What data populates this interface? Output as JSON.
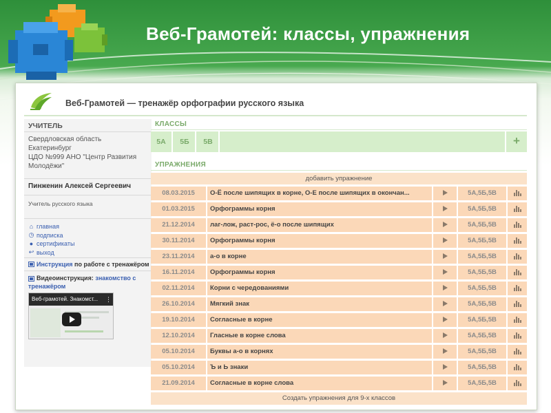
{
  "slide": {
    "title": "Веб-Грамотей: классы, упражнения"
  },
  "app": {
    "title": "Веб-Грамотей — тренажёр орфографии русского языка"
  },
  "sidebar": {
    "heading": "УЧИТЕЛЬ",
    "org_lines": [
      "Свердловская область",
      "Екатеринбург",
      "ЦДО №999 АНО \"Центр Развития",
      "Молодёжи\""
    ],
    "teacher_name": "Пинженин Алексей Сергеевич",
    "teacher_role": "Учитель русского языка",
    "links": [
      {
        "icon": "home-icon",
        "label": "главная"
      },
      {
        "icon": "subscription-icon",
        "label": "подписка"
      },
      {
        "icon": "certificate-icon",
        "label": "сертификаты"
      },
      {
        "icon": "logout-icon",
        "label": "выход"
      }
    ],
    "instruction": {
      "link": "Инструкция",
      "text": " по работе с тренажёром"
    },
    "video": {
      "label": "Видеоинструкция:",
      "link": "знакомство с тренажёром",
      "thumb_title": "Веб-грамотей. Знакомст..."
    }
  },
  "classes": {
    "heading": "КЛАССЫ",
    "items": [
      "5А",
      "5Б",
      "5В"
    ],
    "add_symbol": "+"
  },
  "exercises": {
    "heading": "УПРАЖНЕНИЯ",
    "add_label": "добавить упражнение",
    "rows": [
      {
        "date": "08.03.2015",
        "name": "О-Ё после шипящих в корне, О-Е после шипящих в окончан...",
        "classes": "5А,5Б,5В"
      },
      {
        "date": "01.03.2015",
        "name": "Орфограммы корня",
        "classes": "5А,5Б,5В"
      },
      {
        "date": "21.12.2014",
        "name": "лаг-лож, раст-рос, ё-о после шипящих",
        "classes": "5А,5Б,5В"
      },
      {
        "date": "30.11.2014",
        "name": "Орфограммы корня",
        "classes": "5А,5Б,5В"
      },
      {
        "date": "23.11.2014",
        "name": "а-о в корне",
        "classes": "5А,5Б,5В"
      },
      {
        "date": "16.11.2014",
        "name": "Орфограммы корня",
        "classes": "5А,5Б,5В"
      },
      {
        "date": "02.11.2014",
        "name": "Корни с чередованиями",
        "classes": "5А,5Б,5В"
      },
      {
        "date": "26.10.2014",
        "name": "Мягкий знак",
        "classes": "5А,5Б,5В"
      },
      {
        "date": "19.10.2014",
        "name": "Согласные в корне",
        "classes": "5А,5Б,5В"
      },
      {
        "date": "12.10.2014",
        "name": "Гласные в корне слова",
        "classes": "5А,5Б,5В"
      },
      {
        "date": "05.10.2014",
        "name": "Буквы а-о в корнях",
        "classes": "5А,5Б,5В"
      },
      {
        "date": "05.10.2014",
        "name": "Ъ и Ь знаки",
        "classes": "5А,5Б,5В"
      },
      {
        "date": "21.09.2014",
        "name": "Согласные в корне слова",
        "classes": "5А,5Б,5В"
      }
    ],
    "create_9_label": "Создать упражнения для 9-х классов"
  },
  "colors": {
    "accent_green": "#7aaa6a",
    "row_orange": "#fbd8b8",
    "link_blue": "#3a5fb0"
  }
}
